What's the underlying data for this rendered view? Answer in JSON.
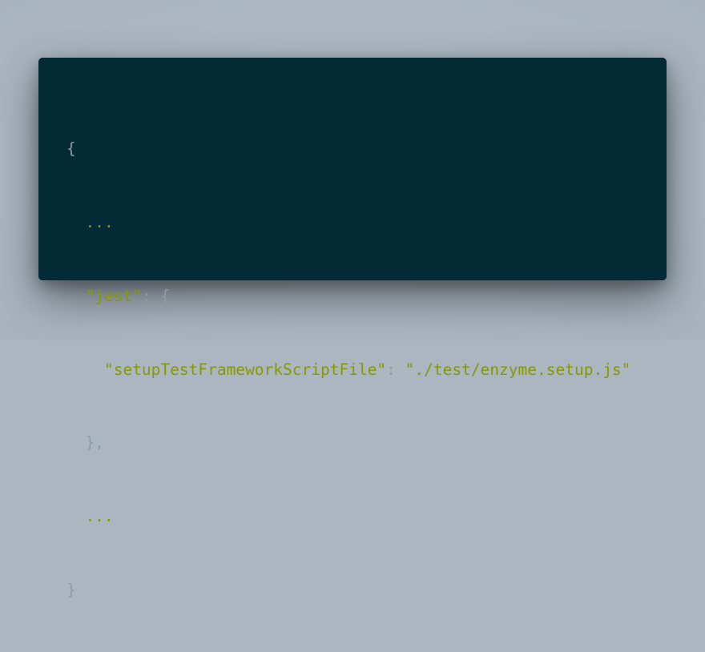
{
  "colors": {
    "background": "#abb6c1",
    "code_background": "#022b36",
    "punctuation": "#8a9da0",
    "string": "#859900"
  },
  "code": {
    "open_brace": "{",
    "ellipsis_top": "...",
    "jest_key": "\"jest\"",
    "jest_colon_brace": ": {",
    "setup_key": "\"setupTestFrameworkScriptFile\"",
    "setup_colon": ": ",
    "setup_value": "\"./test/enzyme.setup.js\"",
    "inner_close": "},",
    "ellipsis_bottom": "...",
    "close_brace": "}"
  }
}
